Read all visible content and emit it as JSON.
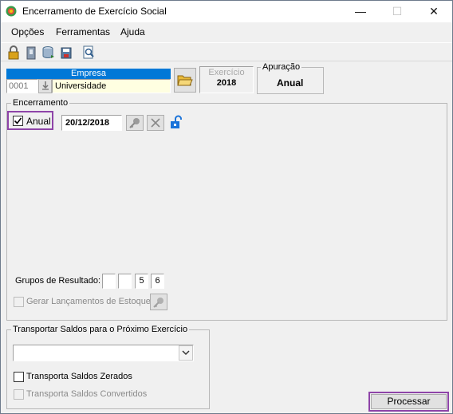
{
  "window": {
    "title": "Encerramento de Exercício Social"
  },
  "menu": [
    {
      "label": "Opções"
    },
    {
      "label": "Ferramentas"
    },
    {
      "label": "Ajuda"
    }
  ],
  "empresa": {
    "header": "Empresa",
    "code": "0001",
    "name": "Universidade"
  },
  "exercicio": {
    "label": "Exercício",
    "value": "2018"
  },
  "apuracao": {
    "label": "Apuração",
    "value": "Anual"
  },
  "encerramento": {
    "title": "Encerramento",
    "anual_label": "Anual",
    "anual_checked": true,
    "date": "20/12/2018",
    "grupos_label": "Grupos de Resultado:",
    "grupos": [
      "",
      "",
      "5",
      "6"
    ],
    "estoque_label": "Gerar Lançamentos de Estoque"
  },
  "transportar": {
    "title": "Transportar Saldos para o Próximo Exercício",
    "select_value": "",
    "zerados_label": "Transporta Saldos Zerados",
    "convertidos_label": "Transporta Saldos Convertidos"
  },
  "processar_label": "Processar",
  "colors": {
    "empresa_header": "#0078d7",
    "highlight": "#8e44a8",
    "name_field": "#ffffe1"
  }
}
